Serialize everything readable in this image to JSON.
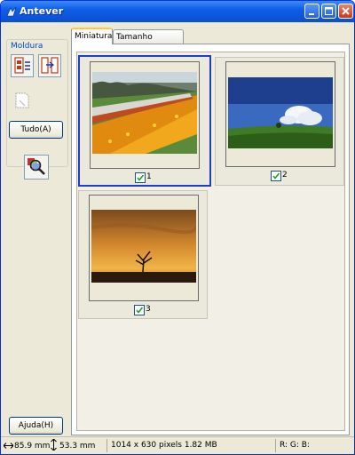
{
  "window": {
    "title": "Antever",
    "accent": "#0a4fd1",
    "selection_color": "#1e3cd2"
  },
  "left_panel": {
    "group_label": "Moldura",
    "icons": [
      "auto-locate-frame-icon",
      "frame-adjust-icon",
      "delete-frame-icon",
      "zoom-preview-icon"
    ],
    "all_button": "Tudo(A)",
    "help_button": "Ajuda(H)"
  },
  "tabs": [
    {
      "label": "Miniatura",
      "active": true
    },
    {
      "label": "Tamanho Completo",
      "active": false
    }
  ],
  "thumbnails": [
    {
      "number": "1",
      "checked": true,
      "selected": true,
      "scene": "flower-field"
    },
    {
      "number": "2",
      "checked": true,
      "selected": false,
      "scene": "sky-meadow"
    },
    {
      "number": "3",
      "checked": true,
      "selected": false,
      "scene": "sunset-tree"
    }
  ],
  "status": {
    "width": "85.9 mm",
    "height": "53.3 mm",
    "pixels": "1014 x 630 pixels 1.82 MB",
    "rgb": "R:  G:  B:"
  }
}
